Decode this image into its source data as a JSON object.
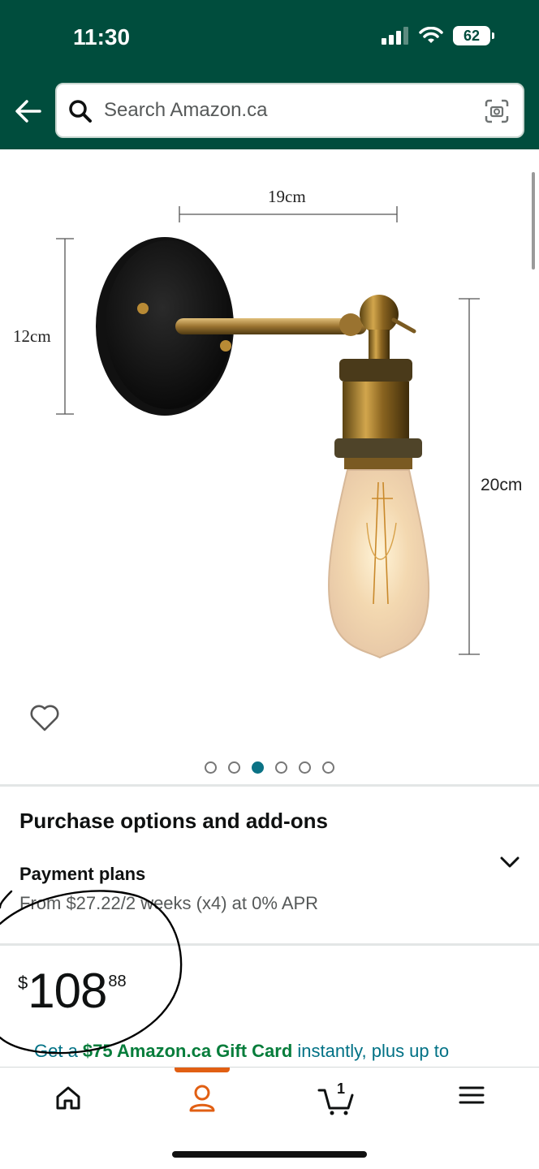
{
  "status_bar": {
    "time": "11:30",
    "battery": "62"
  },
  "header": {
    "back_icon": "arrow-left-icon",
    "search": {
      "placeholder": "Search Amazon.ca"
    },
    "camera_icon": "camera-scan-icon"
  },
  "product_image": {
    "dimensions": {
      "width_label": "19cm",
      "height_left_label": "12cm",
      "height_right_label": "20cm"
    },
    "carousel": {
      "total": 6,
      "active_index": 2
    }
  },
  "purchase_options": {
    "title": "Purchase options and add-ons",
    "payment_plans": {
      "title": "Payment plans",
      "subtitle": "From $27.22/2 weeks (x4) at 0% APR"
    }
  },
  "price": {
    "currency": "$",
    "whole": "108",
    "fraction": "88"
  },
  "promo": {
    "prefix": "Get a ",
    "highlight": "$75 Amazon.ca Gift Card",
    "suffix": " instantly, plus up to"
  },
  "bottom_nav": {
    "items": [
      "home-icon",
      "account-icon",
      "cart-icon",
      "menu-icon"
    ],
    "active": "account-icon",
    "cart_count": "1"
  },
  "colors": {
    "header_bg": "#004d3d",
    "link": "#007185",
    "promo_green": "#067d3b",
    "active_tab": "#e15f13",
    "carousel_active": "#0b7285"
  }
}
